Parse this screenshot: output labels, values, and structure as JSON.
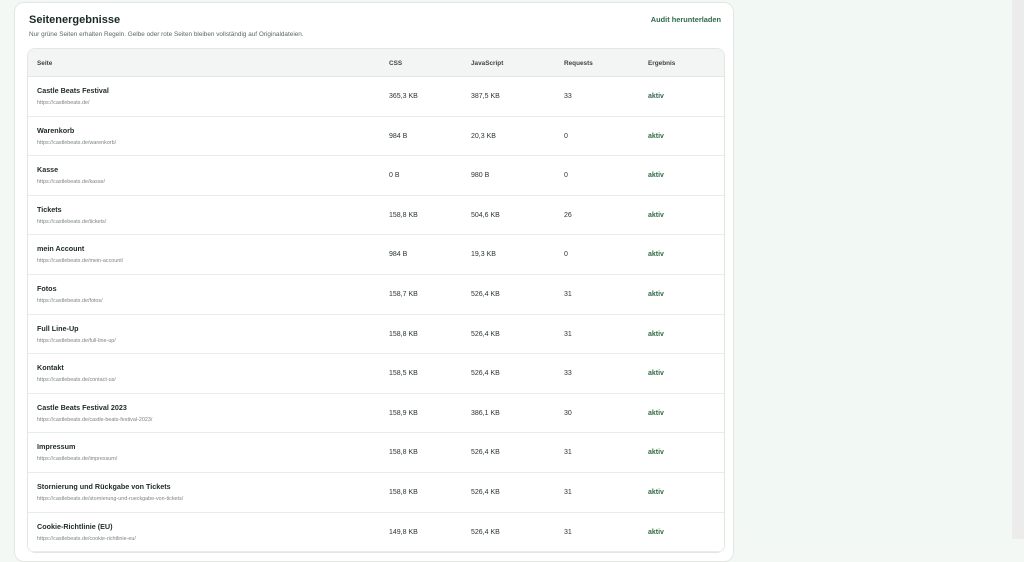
{
  "section": {
    "title": "Seitenergebnisse",
    "subtitle": "Nur grüne Seiten erhalten Regeln. Gelbe oder rote Seiten bleiben vollständig auf Originaldateien.",
    "download_label": "Audit herunterladen"
  },
  "table": {
    "headers": {
      "page": "Seite",
      "css": "CSS",
      "js": "JavaScript",
      "requests": "Requests",
      "result": "Ergebnis"
    },
    "rows": [
      {
        "title": "Castle Beats Festival",
        "url": "https://castlebeats.de/",
        "css": "365,3 KB",
        "js": "387,5 KB",
        "requests": "33",
        "result": "aktiv"
      },
      {
        "title": "Warenkorb",
        "url": "https://castlebeats.de/warenkorb/",
        "css": "984 B",
        "js": "20,3 KB",
        "requests": "0",
        "result": "aktiv"
      },
      {
        "title": "Kasse",
        "url": "https://castlebeats.de/kasse/",
        "css": "0 B",
        "js": "980 B",
        "requests": "0",
        "result": "aktiv"
      },
      {
        "title": "Tickets",
        "url": "https://castlebeats.de/tickets/",
        "css": "158,8 KB",
        "js": "504,6 KB",
        "requests": "26",
        "result": "aktiv"
      },
      {
        "title": "mein Account",
        "url": "https://castlebeats.de/mein-account/",
        "css": "984 B",
        "js": "19,3 KB",
        "requests": "0",
        "result": "aktiv"
      },
      {
        "title": "Fotos",
        "url": "https://castlebeats.de/fotos/",
        "css": "158,7 KB",
        "js": "526,4 KB",
        "requests": "31",
        "result": "aktiv"
      },
      {
        "title": "Full Line-Up",
        "url": "https://castlebeats.de/full-line-up/",
        "css": "158,8 KB",
        "js": "526,4 KB",
        "requests": "31",
        "result": "aktiv"
      },
      {
        "title": "Kontakt",
        "url": "https://castlebeats.de/contact-us/",
        "css": "158,5 KB",
        "js": "526,4 KB",
        "requests": "33",
        "result": "aktiv"
      },
      {
        "title": "Castle Beats Festival 2023",
        "url": "https://castlebeats.de/castle-beats-festival-2023/",
        "css": "158,9 KB",
        "js": "386,1 KB",
        "requests": "30",
        "result": "aktiv"
      },
      {
        "title": "Impressum",
        "url": "https://castlebeats.de/impressum/",
        "css": "158,8 KB",
        "js": "526,4 KB",
        "requests": "31",
        "result": "aktiv"
      },
      {
        "title": "Stornierung und Rückgabe von Tickets",
        "url": "https://castlebeats.de/stornierung-und-rueckgabe-von-tickets/",
        "css": "158,8 KB",
        "js": "526,4 KB",
        "requests": "31",
        "result": "aktiv"
      },
      {
        "title": "Cookie-Richtlinie (EU)",
        "url": "https://castlebeats.de/cookie-richtlinie-eu/",
        "css": "149,8 KB",
        "js": "526,4 KB",
        "requests": "31",
        "result": "aktiv"
      }
    ]
  }
}
